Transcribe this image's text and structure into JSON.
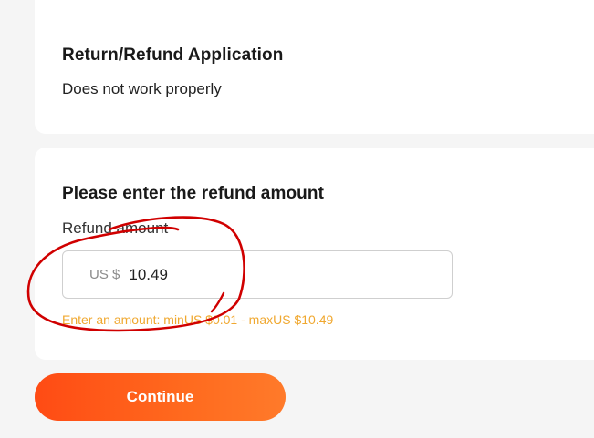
{
  "application": {
    "title": "Return/Refund Application",
    "reason": "Does not work properly"
  },
  "refund": {
    "title": "Please enter the refund amount",
    "field_label": "Refund amount",
    "currency": "US $",
    "amount": "10.49",
    "hint": "Enter an amount: minUS $0.01 - maxUS $10.49"
  },
  "actions": {
    "continue_label": "Continue"
  },
  "colors": {
    "accent": "#ff5a1f",
    "hint": "#f0a830",
    "annotation": "#d00000"
  }
}
